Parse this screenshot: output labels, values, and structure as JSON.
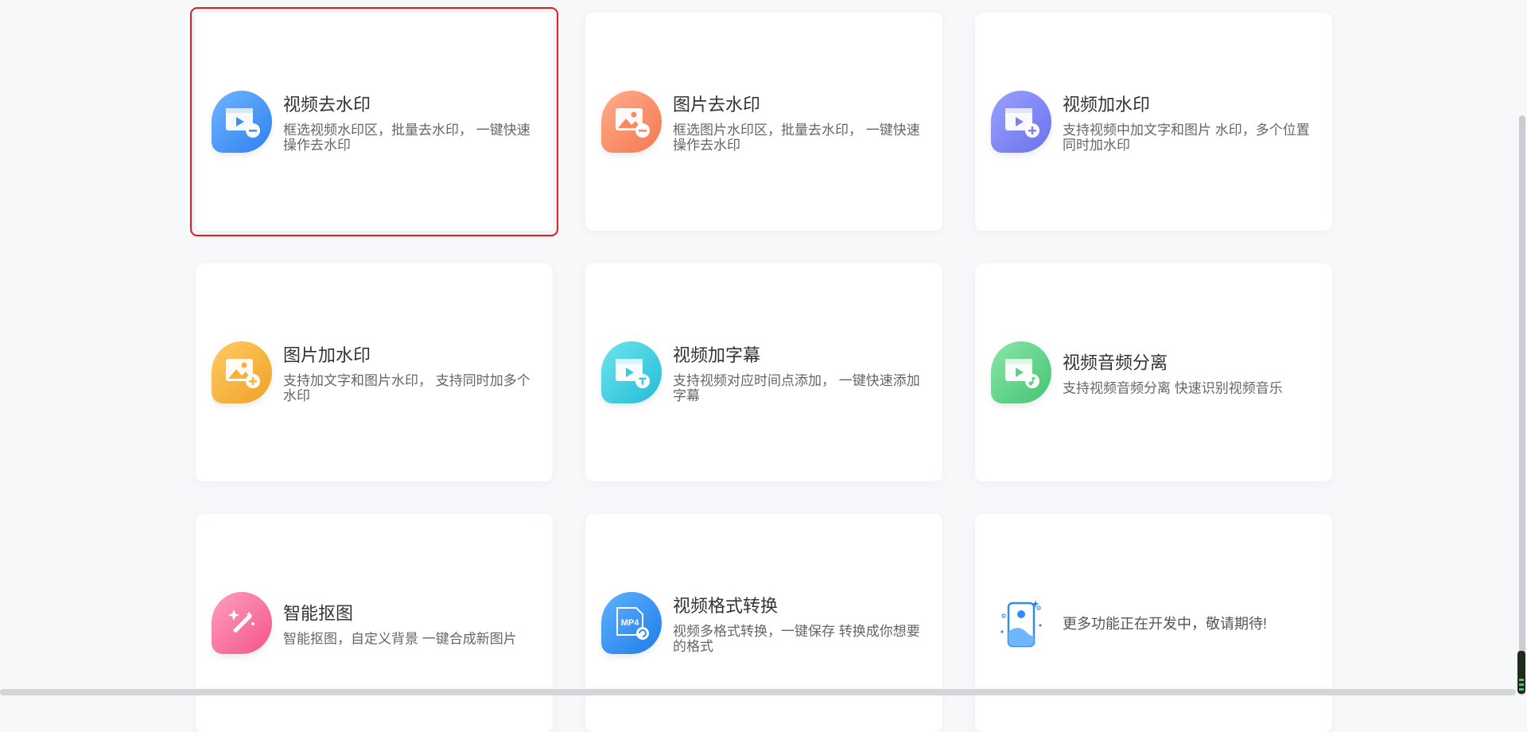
{
  "features": [
    {
      "title": "视频去水印",
      "desc": "框选视频水印区，批量去水印， 一键快速操作去水印",
      "icon": "video-remove-watermark-icon",
      "color": "#3d8ff5",
      "selected": true
    },
    {
      "title": "图片去水印",
      "desc": "框选图片水印区，批量去水印， 一键快速操作去水印",
      "icon": "image-remove-watermark-icon",
      "color": "#f78a64"
    },
    {
      "title": "视频加水印",
      "desc": "支持视频中加文字和图片 水印，多个位置同时加水印",
      "icon": "video-add-watermark-icon",
      "color": "#7b83f2"
    },
    {
      "title": "图片加水印",
      "desc": "支持加文字和图片水印， 支持同时加多个水印",
      "icon": "image-add-watermark-icon",
      "color": "#f6b23a"
    },
    {
      "title": "视频加字幕",
      "desc": "支持视频对应时间点添加， 一键快速添加字幕",
      "icon": "video-add-subtitle-icon",
      "color": "#35cfe0"
    },
    {
      "title": "视频音频分离",
      "desc": "支持视频音频分离 快速识别视频音乐",
      "icon": "video-audio-separate-icon",
      "color": "#5fd187"
    },
    {
      "title": "智能抠图",
      "desc": "智能抠图，自定义背景 一键合成新图片",
      "icon": "magic-wand-icon",
      "color": "#f9699a"
    },
    {
      "title": "视频格式转换",
      "desc": "视频多格式转换，一键保存 转换成你想要的格式",
      "icon": "mp4-convert-icon",
      "color": "#2f8ff0",
      "badge": "MP4"
    }
  ],
  "more": {
    "text": "更多功能正在开发中，敬请期待!",
    "icon": "coming-soon-phone-icon"
  }
}
